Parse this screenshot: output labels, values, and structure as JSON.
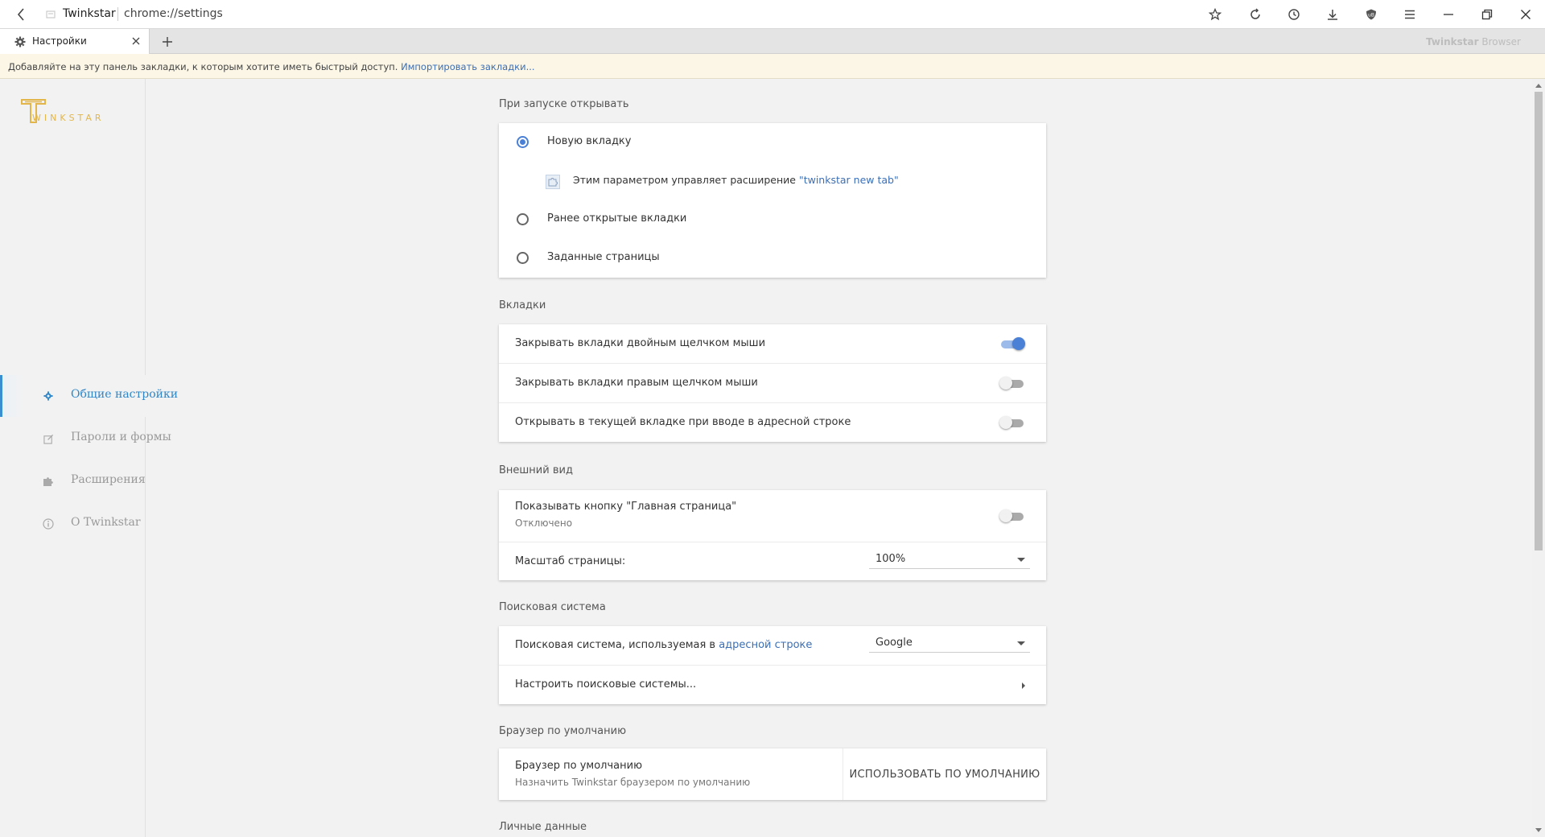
{
  "topbar": {
    "site_name": "Twinkstar",
    "url": "chrome://settings",
    "buttons": [
      "star-icon",
      "sync-icon",
      "history-icon",
      "download-icon",
      "shield-icon",
      "menu-icon",
      "minimize-icon",
      "restore-icon",
      "close-icon"
    ]
  },
  "tab": {
    "title": "Настройки"
  },
  "watermark": {
    "brand": "Twinkstar",
    "suffix": " Browser"
  },
  "bookmarks": {
    "text": "Добавляйте на эту панель закладки, к которым хотите иметь быстрый доступ. ",
    "link": "Импортировать закладки..."
  },
  "logo": {
    "text": "WINKSTAR",
    "color": "#e2b64a"
  },
  "sidebar": {
    "items": [
      {
        "label": "Общие настройки",
        "icon": "gear-icon",
        "active": true
      },
      {
        "label": "Пароли и формы",
        "icon": "edit-icon",
        "active": false
      },
      {
        "label": "Расширения",
        "icon": "puzzle-icon",
        "active": false
      },
      {
        "label": "О Twinkstar",
        "icon": "info-icon",
        "active": false
      }
    ]
  },
  "startup": {
    "title": "При запуске открывать",
    "opt_newtab": "Новую вкладку",
    "managed_prefix": "Этим параметром управляет расширение ",
    "managed_link": "\"twinkstar new tab\"",
    "opt_previous": "Ранее открытые вкладки",
    "opt_pages": "Заданные страницы"
  },
  "tabs_section": {
    "title": "Вкладки",
    "dbl_click": "Закрывать вкладки двойным щелчком мыши",
    "right_click": "Закрывать вкладки правым щелчком мыши",
    "open_current": "Открывать в текущей вкладке при вводе в адресной строке",
    "dbl_click_on": true,
    "right_click_on": false,
    "open_current_on": false
  },
  "appearance": {
    "title": "Внешний вид",
    "home_button": "Показывать кнопку \"Главная страница\"",
    "home_button_sub": "Отключено",
    "home_button_on": false,
    "zoom_label": "Масштаб страницы:",
    "zoom_value": "100%"
  },
  "search": {
    "title": "Поисковая система",
    "engine_prefix": "Поисковая система, используемая в ",
    "engine_link": "адресной строке",
    "engine_value": "Google",
    "manage": "Настроить поисковые системы..."
  },
  "default_browser": {
    "title": "Браузер по умолчанию",
    "label": "Браузер по умолчанию",
    "sub": "Назначить Twinkstar браузером по умолчанию",
    "button": "ИСПОЛЬЗОВАТЬ ПО УМОЛЧАНИЮ"
  },
  "personal": {
    "title": "Личные данные"
  },
  "colors": {
    "accent": "#4a80d6",
    "nav_active": "#2f86c9",
    "link": "#3b6fb6"
  }
}
